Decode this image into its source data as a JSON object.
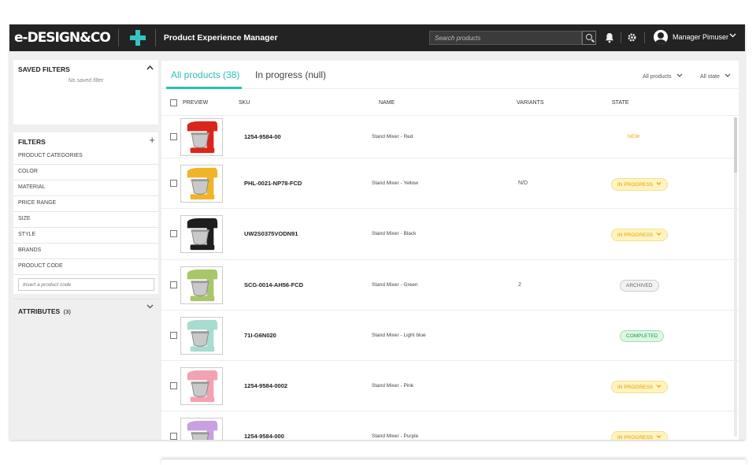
{
  "header": {
    "logo": "e-DESIGN&CO",
    "app_title": "Product Experience Manager",
    "search_placeholder": "Search products",
    "user_name": "Manager Pimuser",
    "chevron": "⌄"
  },
  "sidebar": {
    "saved_filters_title": "SAVED FILTERS",
    "saved_toggle": "^",
    "no_saved": "No saved filter",
    "filters_title": "FILTERS",
    "filters_add": "+",
    "filter_items": [
      "PRODUCT CATEGORIES",
      "COLOR",
      "MATERIAL",
      "PRICE RANGE",
      "SIZE",
      "STYLE",
      "BRANDS",
      "PRODUCT CODE"
    ],
    "code_placeholder": "Insert a product code",
    "attributes_title": "ATTRIBUTES",
    "attributes_count": "(3)"
  },
  "main": {
    "tabs": [
      {
        "label": "All products (38)"
      },
      {
        "label": "In progress (null)"
      }
    ],
    "filter_products": "All products",
    "filter_state": "All state",
    "columns": {
      "preview": "PREVIEW",
      "sku": "SKU",
      "name": "NAME",
      "variants": "VARIANTS",
      "state": "STATE"
    },
    "rows": [
      {
        "sku": "1254-9584-00",
        "name": "Stand Mixer - Red",
        "variants": "",
        "state": "NEW",
        "state_type": "new",
        "color": "#d9261c"
      },
      {
        "sku": "PHL-0021-NP78-FCD",
        "name": "Stand Mixer - Yellow",
        "variants": "N/D",
        "state": "IN PROGRESS",
        "state_type": "progress",
        "color": "#f0b429"
      },
      {
        "sku": "UW2S0375VODN91",
        "name": "Stand Mixer - Black",
        "variants": "",
        "state": "IN PROGRESS",
        "state_type": "progress",
        "color": "#1e1e1e"
      },
      {
        "sku": "SCG-0014-AH56-FCD",
        "name": "Stand Mixer - Green",
        "variants": "2",
        "state": "ARCHIVED",
        "state_type": "archived",
        "color": "#a8c76a"
      },
      {
        "sku": "71I-G6N020",
        "name": "Stand Mixer - Light blue",
        "variants": "",
        "state": "COMPLETED",
        "state_type": "completed",
        "color": "#a8dcd0"
      },
      {
        "sku": "1254-9584-0002",
        "name": "Stand Mixer - Pink",
        "variants": "",
        "state": "IN PROGRESS",
        "state_type": "progress",
        "color": "#f2a3b3"
      },
      {
        "sku": "1254-9584-000",
        "name": "Stand Mixer - Purple",
        "variants": "",
        "state": "IN PROGRESS",
        "state_type": "progress",
        "color": "#c9a0e0"
      }
    ]
  },
  "colors": {
    "accent": "#2bbfb6",
    "topbar": "#232323",
    "logo_plus": "#37c3c3"
  }
}
